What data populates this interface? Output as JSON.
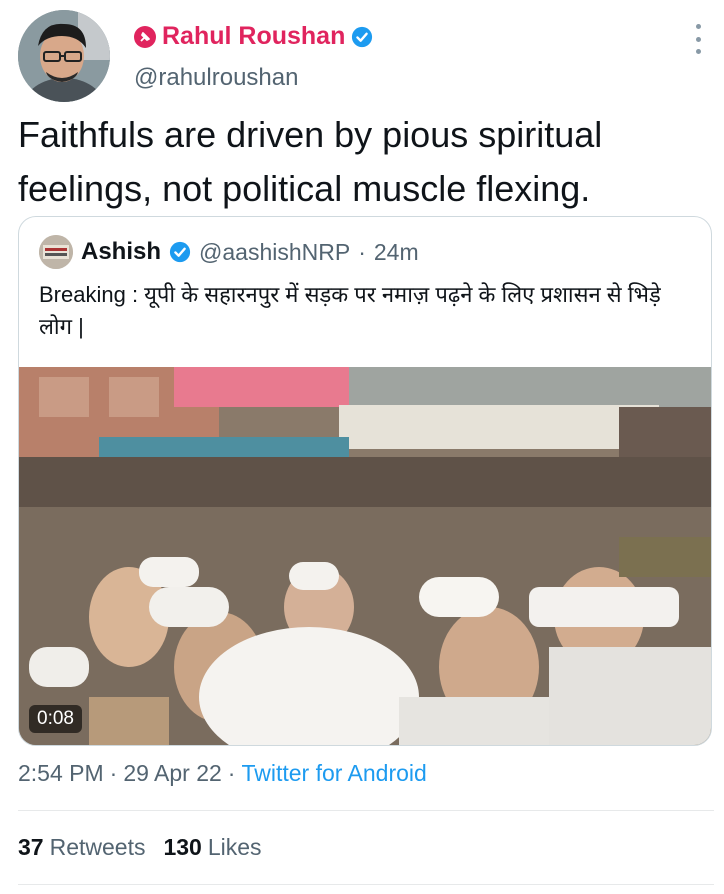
{
  "author": {
    "name": "Rahul Roushan",
    "handle": "@rahulroushan"
  },
  "tweet": {
    "text": "Faithfuls are driven by pious spiritual feelings, not political muscle flexing."
  },
  "quoted_tweet": {
    "name": "Ashish",
    "handle": "@aashishNRP",
    "separator": "·",
    "time": "24m",
    "text": "Breaking : यूपी के सहारनपुर में सड़क पर नमाज़ पढ़ने के लिए प्रशासन से भिड़े लोग |",
    "video_duration": "0:08"
  },
  "meta": {
    "time": "2:54 PM",
    "dot1": "·",
    "date": "29 Apr 22",
    "dot2": "·",
    "source": "Twitter for Android"
  },
  "stats": {
    "retweets_count": "37",
    "retweets_label": "Retweets",
    "likes_count": "130",
    "likes_label": "Likes"
  },
  "colors": {
    "name_pink": "#e0245e",
    "verified_blue": "#1d9bf0",
    "muted": "#536471",
    "link": "#1d9bf0"
  }
}
